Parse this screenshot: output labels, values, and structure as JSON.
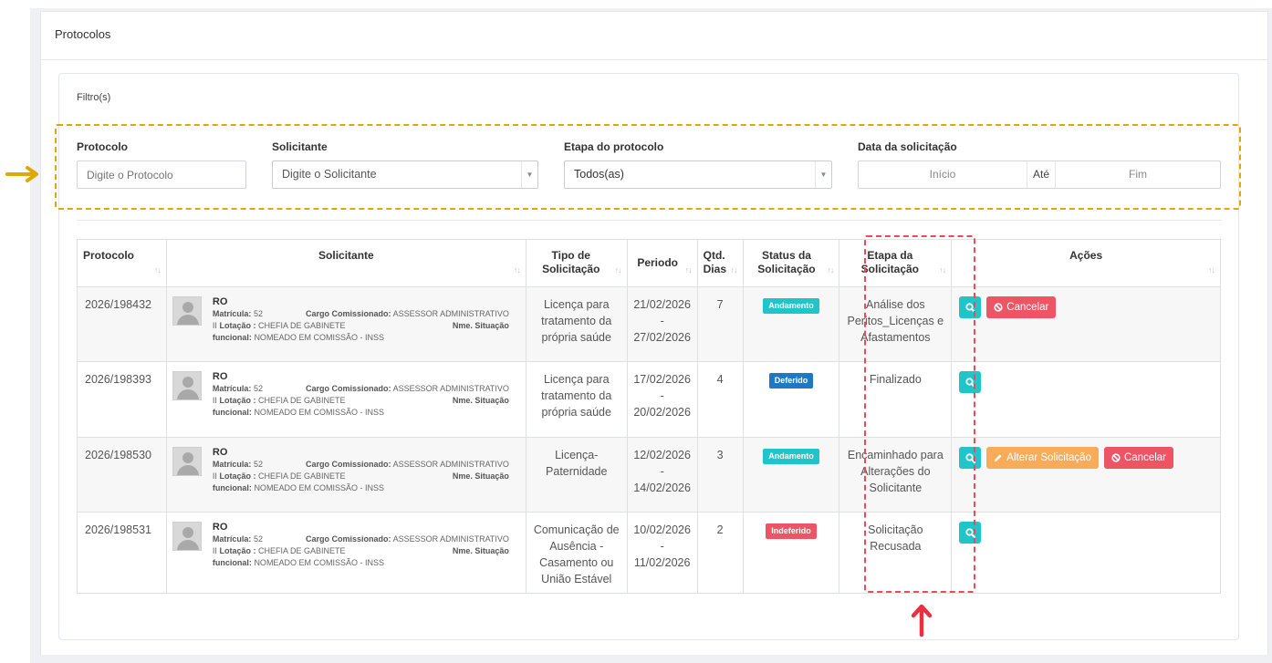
{
  "panel": {
    "title": "Protocolos"
  },
  "filter": {
    "section_title": "Filtro(s)",
    "protocolo": {
      "label": "Protocolo",
      "placeholder": "Digite o Protocolo"
    },
    "solicitante": {
      "label": "Solicitante",
      "value": "Digite o Solicitante"
    },
    "etapa": {
      "label": "Etapa do protocolo",
      "value": "Todos(as)"
    },
    "data": {
      "label": "Data da solicitação",
      "inicio": "Início",
      "ate": "Até",
      "fim": "Fim"
    }
  },
  "table": {
    "headers": {
      "protocolo": "Protocolo",
      "solicitante": "Solicitante",
      "tipo_l1": "Tipo de",
      "tipo_l2": "Solicitação",
      "periodo": "Periodo",
      "qtd_l1": "Qtd.",
      "qtd_l2": "Dias",
      "status_l1": "Status da",
      "status_l2": "Solicitação",
      "etapa_l1": "Etapa da",
      "etapa_l2": "Solicitação",
      "acoes": "Ações"
    },
    "labels": {
      "matricula": "Matrícula:",
      "cargo": "Cargo Comissionado:",
      "lotacao": "Lotação :",
      "situacao": "Nme. Situação",
      "funcional": "funcional:"
    },
    "rows": [
      {
        "protocolo": "2026/198432",
        "nome": "RO",
        "matricula": "52",
        "cargo": "ASSESSOR ADMINISTRATIVO",
        "lotacao_prefix": "II",
        "lotacao": "CHEFIA DE GABINETE",
        "funcional": "NOMEADO EM COMISSÃO - INSS",
        "tipo": "Licença para tratamento da própria saúde",
        "periodo_inicio": "21/02/2026",
        "periodo_sep": "-",
        "periodo_fim": "27/02/2026",
        "dias": "7",
        "status": "Andamento",
        "etapa": "Análise dos Peritos_Licenças e Afastamentos",
        "cancelar": "Cancelar"
      },
      {
        "protocolo": "2026/198393",
        "nome": "RO",
        "matricula": "52",
        "cargo": "ASSESSOR ADMINISTRATIVO",
        "lotacao_prefix": "II",
        "lotacao": "CHEFIA DE GABINETE",
        "funcional": "NOMEADO EM COMISSÃO - INSS",
        "tipo": "Licença para tratamento da própria saúde",
        "periodo_inicio": "17/02/2026",
        "periodo_sep": "-",
        "periodo_fim": "20/02/2026",
        "dias": "4",
        "status": "Deferido",
        "etapa": "Finalizado"
      },
      {
        "protocolo": "2026/198530",
        "nome": "RO",
        "matricula": "52",
        "cargo": "ASSESSOR ADMINISTRATIVO",
        "lotacao_prefix": "II",
        "lotacao": "CHEFIA DE GABINETE",
        "funcional": "NOMEADO EM COMISSÃO - INSS",
        "tipo": "Licença-Paternidade",
        "periodo_inicio": "12/02/2026",
        "periodo_sep": "-",
        "periodo_fim": "14/02/2026",
        "dias": "3",
        "status": "Andamento",
        "etapa": "Encaminhado para Alterações do Solicitante",
        "alterar": "Alterar Solicitação",
        "cancelar": "Cancelar"
      },
      {
        "protocolo": "2026/198531",
        "nome": "RO",
        "matricula": "52",
        "cargo": "ASSESSOR ADMINISTRATIVO",
        "lotacao_prefix": "II",
        "lotacao": "CHEFIA DE GABINETE",
        "funcional": "NOMEADO EM COMISSÃO - INSS",
        "tipo": "Comunicação de Ausência - Casamento ou União Estável",
        "periodo_inicio": "10/02/2026",
        "periodo_sep": "-",
        "periodo_fim": "11/02/2026",
        "dias": "2",
        "status": "Indeferido",
        "etapa": "Solicitação Recusada"
      }
    ]
  },
  "annotations": {
    "filter_box_color": "#e0a800",
    "etapa_box_color": "#e94b5a"
  },
  "icons": {
    "search": "search-icon",
    "cancel": "ban-icon",
    "alter": "pencil-icon",
    "sort": "sort-icon",
    "caret": "chevron-down-icon"
  }
}
